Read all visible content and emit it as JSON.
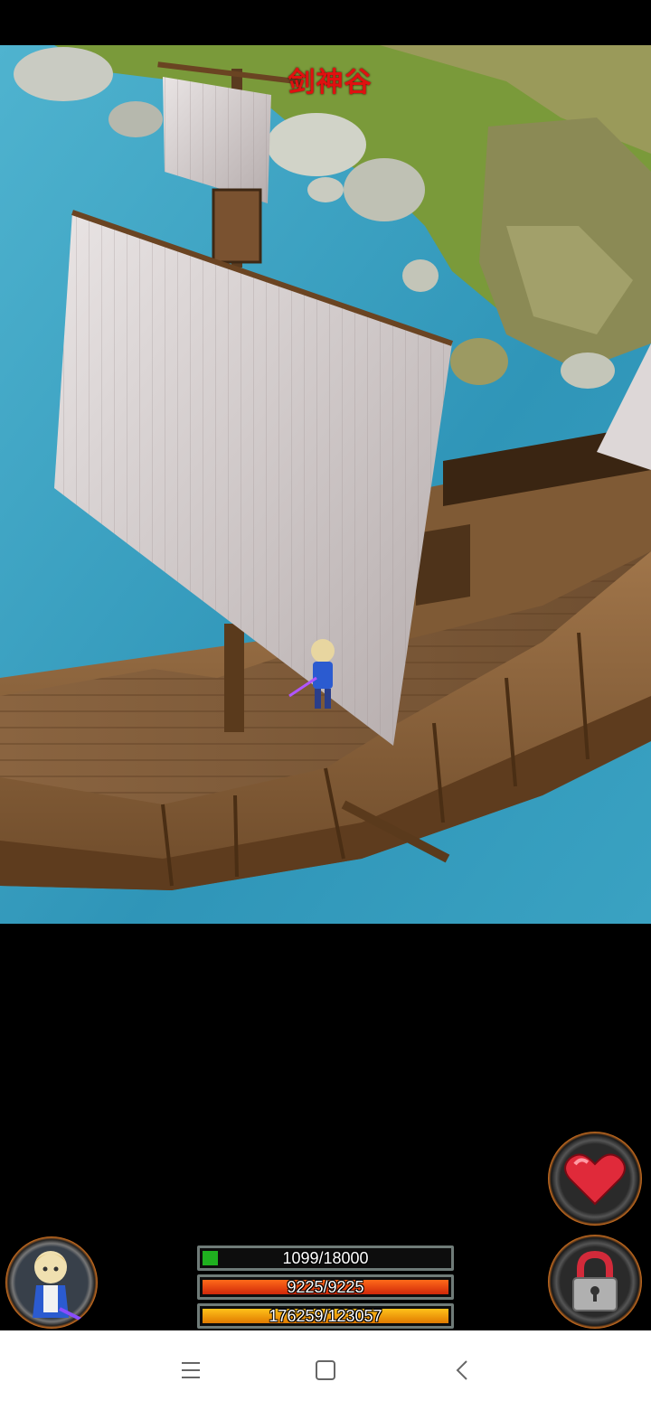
{
  "map": {
    "location_name": "剑神谷"
  },
  "hud": {
    "exp": {
      "text": "1099/18000",
      "fraction": 0.061
    },
    "hp": {
      "text": "9225/9225",
      "fraction": 1.0
    },
    "mp": {
      "text": "176259/123057",
      "fraction": 1.0
    },
    "heart_button_icon": "heart-icon",
    "lock_button_icon": "padlock-icon",
    "avatar_icon": "character-portrait"
  },
  "navigation": {
    "menu_icon": "menu-icon",
    "home_icon": "home-square-icon",
    "back_icon": "back-chevron-icon"
  },
  "colors": {
    "location_text": "#e01010",
    "exp_fill": "#1fb01f",
    "hp_fill": "#d0280a",
    "mp_fill": "#e07a00",
    "water": "#3a9fbf"
  }
}
